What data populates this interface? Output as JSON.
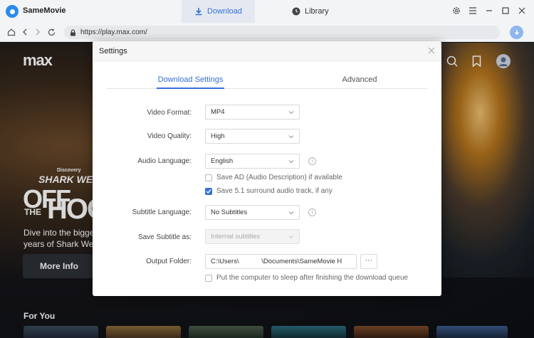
{
  "app": {
    "name": "SameMovie"
  },
  "tabs": {
    "download": "Download",
    "library": "Library"
  },
  "address": {
    "url": "https://play.max.com/"
  },
  "site": {
    "logo": "max",
    "hero_network": "Discovery",
    "hero_series": "SHARK WEEK",
    "hero_title_top": "OFF",
    "hero_title_the": "THE",
    "hero_title_main": "HOO",
    "hero_description": "Dive into the bigge years of Shark We",
    "more_info": "More Info",
    "section": "For You"
  },
  "dialog": {
    "title": "Settings",
    "tab_download": "Download Settings",
    "tab_advanced": "Advanced",
    "video_format": {
      "label": "Video Format:",
      "value": "MP4"
    },
    "video_quality": {
      "label": "Video Quality:",
      "value": "High"
    },
    "audio_language": {
      "label": "Audio Language:",
      "value": "English"
    },
    "save_ad": {
      "label": "Save AD (Audio Description) if available",
      "checked": false
    },
    "save_51": {
      "label": "Save 5.1 surround audio track, if any",
      "checked": true
    },
    "subtitle_language": {
      "label": "Subtitle Language:",
      "value": "No Subtitles"
    },
    "save_subtitle": {
      "label": "Save Subtitle as:",
      "value": "Internal subtitles"
    },
    "output_folder": {
      "label": "Output Folder:",
      "value": "C:\\Users\\            \\Documents\\SameMovie H"
    },
    "browse_label": "···",
    "sleep": {
      "label": "Put the computer to sleep after finishing the download queue",
      "checked": false
    }
  },
  "colors": {
    "accent": "#3570d6",
    "titlebar": "#f3f4f6",
    "app_logo": "#2b8ce8"
  },
  "icons": [
    "app-logo-icon",
    "download-icon",
    "clock-icon",
    "gear-icon",
    "menu-icon",
    "minimize-icon",
    "maximize-icon",
    "close-icon",
    "home-icon",
    "back-icon",
    "forward-icon",
    "reload-icon",
    "lock-icon",
    "download-circle-icon",
    "search-icon",
    "bookmark-icon",
    "profile-icon",
    "chevron-down-icon",
    "info-icon",
    "check-icon"
  ]
}
